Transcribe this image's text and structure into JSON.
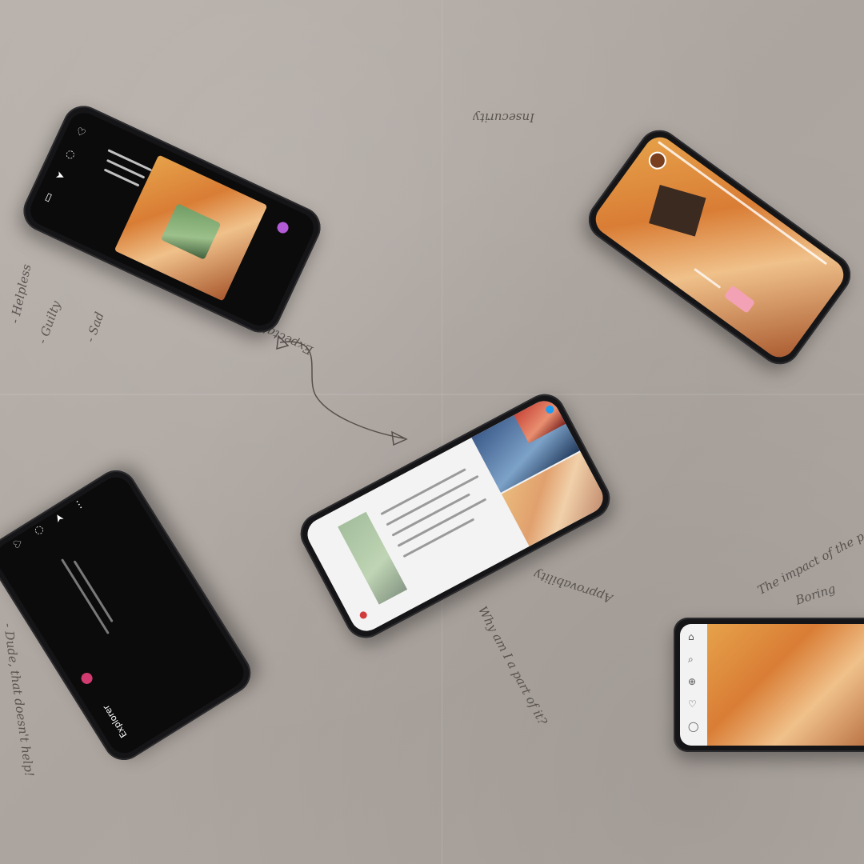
{
  "notes": {
    "n1": "Insecurity",
    "n2": "- Helpless",
    "n3": "- Guilty",
    "n4": "- Sad",
    "n5": "Expectations 2",
    "n6": "Why am I a part of it?",
    "n7": "Approvability",
    "n8": "The impact of the pandemic",
    "n9": "Boring",
    "n10": "- Dude, that doesn't help!"
  },
  "phones": {
    "p4_header": "Explorer"
  },
  "colors": {
    "paper": "#b1a9a3",
    "ink": "#4a4542",
    "accent_pink": "#d13b6f",
    "phone_body": "#151517"
  }
}
